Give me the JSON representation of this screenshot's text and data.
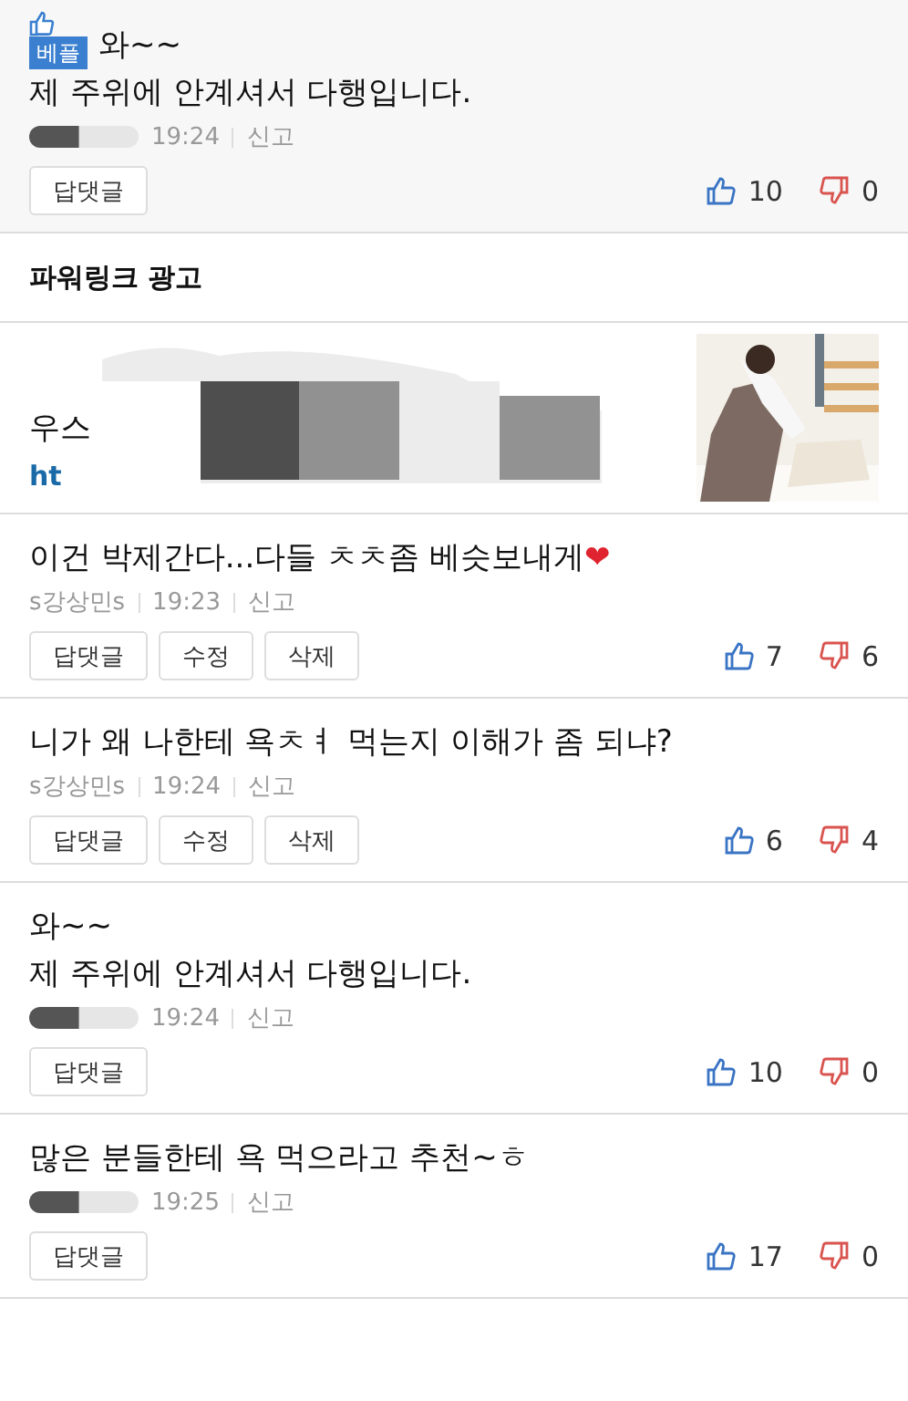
{
  "comments_top": [
    {
      "best": true,
      "badge": "베플",
      "lines": [
        "와~~",
        "제 주위에 안계셔서 다행입니다."
      ],
      "author_hidden": true,
      "time": "19:24",
      "report": "신고",
      "buttons": [
        "답댓글"
      ],
      "likes": "10",
      "dislikes": "0"
    }
  ],
  "ad_section": {
    "title": "파워링크 광고",
    "ad_title": "우스",
    "ad_url": "ht",
    "kind": "picture"
  },
  "comments": [
    {
      "best": false,
      "lines": [
        "이건 박제간다...다들 ㅊㅊ좀 베슷보내게"
      ],
      "emoji": "❤",
      "author_hidden": false,
      "author": "s강상민s",
      "time": "19:23",
      "report": "신고",
      "buttons": [
        "답댓글",
        "수정",
        "삭제"
      ],
      "likes": "7",
      "dislikes": "6"
    },
    {
      "best": false,
      "lines": [
        "니가 왜 나한테 욕ㅊㅕ 먹는지 이해가 좀 되냐?"
      ],
      "author_hidden": false,
      "author": "s강상민s",
      "time": "19:24",
      "report": "신고",
      "buttons": [
        "답댓글",
        "수정",
        "삭제"
      ],
      "likes": "6",
      "dislikes": "4"
    },
    {
      "best": false,
      "lines": [
        "와~~",
        "제 주위에 안계셔서 다행입니다."
      ],
      "author_hidden": true,
      "time": "19:24",
      "report": "신고",
      "buttons": [
        "답댓글"
      ],
      "likes": "10",
      "dislikes": "0"
    },
    {
      "best": false,
      "lines": [
        "많은 분들한테 욕 먹으라고 추천~ㅎ"
      ],
      "author_hidden": true,
      "time": "19:25",
      "report": "신고",
      "buttons": [
        "답댓글"
      ],
      "likes": "17",
      "dislikes": "0"
    }
  ]
}
